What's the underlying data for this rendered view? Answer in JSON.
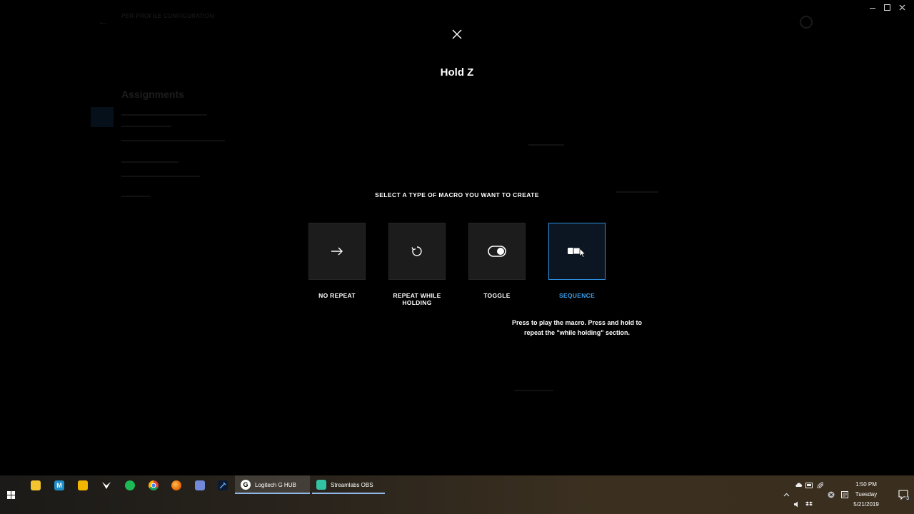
{
  "window": {
    "controls": [
      "minimize",
      "maximize",
      "close"
    ]
  },
  "background": {
    "profile_line1": "PER-PROFILE CONFIGURATION",
    "profile_line2": "",
    "assignments_title": "Assignments"
  },
  "dialog": {
    "title": "Hold Z",
    "prompt": "SELECT A TYPE OF MACRO YOU WANT TO CREATE",
    "options": [
      {
        "label": "NO REPEAT",
        "icon": "arrow-right-icon"
      },
      {
        "label": "REPEAT WHILE HOLDING",
        "icon": "repeat-icon"
      },
      {
        "label": "TOGGLE",
        "icon": "toggle-icon"
      },
      {
        "label": "SEQUENCE",
        "icon": "sequence-icon",
        "selected": true
      }
    ],
    "description": "Press to play the macro. Press and hold to repeat the \"while holding\" section.",
    "accent_color": "#2e8fe0",
    "selected_label_color": "#3aa0ef"
  },
  "taskbar": {
    "pinned_icons": [
      "file-explorer-icon",
      "app-icon",
      "notes-icon",
      "corsair-icon",
      "spotify-icon",
      "chrome-icon",
      "firefox-icon",
      "discord-icon",
      "sword-icon"
    ],
    "apps": [
      {
        "label": "Logitech G HUB",
        "icon": "logitech-g-icon",
        "active": true
      },
      {
        "label": "Streamlabs OBS",
        "icon": "streamlabs-icon",
        "active": false
      }
    ],
    "clock": {
      "time": "1:50 PM",
      "day": "Tuesday",
      "date": "5/21/2019"
    },
    "notification_count": "3"
  }
}
